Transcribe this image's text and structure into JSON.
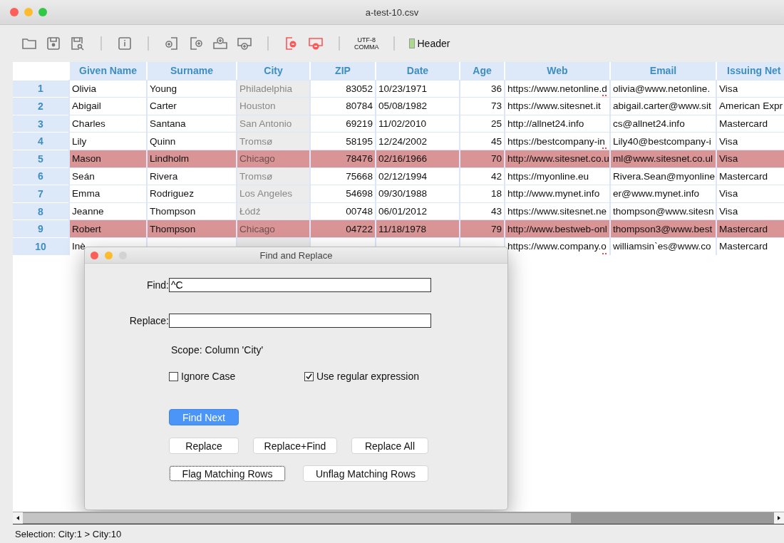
{
  "window": {
    "title": "a-test-10.csv"
  },
  "toolbar": {
    "encoding": "UTF-8",
    "delimiter": "COMMA",
    "header": {
      "label": "Header",
      "checked": true
    }
  },
  "table": {
    "columns": [
      {
        "label": "Given Name",
        "kind": "text",
        "selected": false
      },
      {
        "label": "Surname",
        "kind": "text",
        "selected": false
      },
      {
        "label": "City",
        "kind": "text",
        "selected": true
      },
      {
        "label": "ZIP",
        "kind": "number",
        "selected": false
      },
      {
        "label": "Date",
        "kind": "text",
        "selected": false
      },
      {
        "label": "Age",
        "kind": "number",
        "selected": false
      },
      {
        "label": "Web",
        "kind": "text",
        "selected": false
      },
      {
        "label": "Email",
        "kind": "text",
        "selected": false
      },
      {
        "label": "Issuing Net",
        "kind": "text",
        "selected": false
      }
    ],
    "rows": [
      {
        "number": "1",
        "flagged": false,
        "web_mark": true,
        "cells": [
          "Olivia",
          "Young",
          "Philadelphia",
          "83052",
          "10/23/1971",
          "36",
          "https://www.netonline.d",
          "olivia@www.netonline.",
          "Visa"
        ]
      },
      {
        "number": "2",
        "flagged": false,
        "web_mark": false,
        "cells": [
          "Abigail",
          "Carter",
          "Houston",
          "80784",
          "05/08/1982",
          "73",
          "https://www.sitesnet.it",
          "abigail.carter@www.sit",
          "American Expr"
        ]
      },
      {
        "number": "3",
        "flagged": false,
        "web_mark": false,
        "cells": [
          "Charles",
          "Santana",
          "San Antonio",
          "69219",
          "11/02/2010",
          "25",
          "http://allnet24.info",
          "cs@allnet24.info",
          "Mastercard"
        ]
      },
      {
        "number": "4",
        "flagged": false,
        "web_mark": true,
        "cells": [
          "Lily",
          "Quinn",
          "Tromsø",
          "58195",
          "12/24/2002",
          "45",
          "https://bestcompany-in",
          "Lily40@bestcompany-i",
          "Visa"
        ]
      },
      {
        "number": "5",
        "flagged": true,
        "web_mark": false,
        "cells": [
          "Mason",
          "Lindholm",
          "Chicago",
          "78476",
          "02/16/1966",
          "70",
          "http://www.sitesnet.co.u",
          "ml@www.sitesnet.co.ul",
          "Visa"
        ]
      },
      {
        "number": "6",
        "flagged": false,
        "web_mark": false,
        "cells": [
          "Seán",
          "Rivera",
          "Tromsø",
          "75668",
          "02/12/1994",
          "42",
          "https://myonline.eu",
          "Rivera.Sean@myonline",
          "Mastercard"
        ]
      },
      {
        "number": "7",
        "flagged": false,
        "web_mark": false,
        "cells": [
          "Emma",
          "Rodriguez",
          "Los Angeles",
          "54698",
          "09/30/1988",
          "18",
          "http://www.mynet.info",
          "er@www.mynet.info",
          "Visa"
        ]
      },
      {
        "number": "8",
        "flagged": false,
        "web_mark": false,
        "cells": [
          "Jeanne",
          "Thompson",
          "Łódź",
          "00748",
          "06/01/2012",
          "43",
          "https://www.sitesnet.ne",
          "thompson@www.sitesn",
          "Visa"
        ]
      },
      {
        "number": "9",
        "flagged": true,
        "web_mark": false,
        "cells": [
          "Robert",
          "Thompson",
          "Chicago",
          "04722",
          "11/18/1978",
          "79",
          "http://www.bestweb-onl",
          "thompson3@www.best",
          "Mastercard"
        ]
      },
      {
        "number": "10",
        "flagged": false,
        "web_mark": true,
        "cells": [
          "Inè",
          null,
          null,
          null,
          null,
          null,
          "https://www.company.o",
          "williamsin`es@www.co",
          "Mastercard"
        ]
      }
    ]
  },
  "dialog": {
    "title": "Find and Replace",
    "find": {
      "label": "Find:",
      "value": "^C"
    },
    "replace": {
      "label": "Replace:"
    },
    "scope": "Scope: Column 'City'",
    "options": [
      {
        "label": "Ignore Case",
        "checked": false
      },
      {
        "label": "Use regular expression",
        "checked": true
      }
    ],
    "button_rows": [
      [
        {
          "label": "Find Next",
          "kind": "primary",
          "focused": false
        }
      ],
      [
        {
          "label": "Replace",
          "kind": "normal",
          "focused": false
        },
        {
          "label": "Replace+Find",
          "kind": "normal",
          "focused": false
        },
        {
          "label": "Replace All",
          "kind": "normal",
          "focused": false
        }
      ],
      [
        {
          "label": "Flag Matching Rows",
          "kind": "normal",
          "focused": true
        },
        {
          "label": "Unflag Matching Rows",
          "kind": "normal",
          "focused": false
        }
      ]
    ]
  },
  "status_bar": "Selection: City:1 > City:10"
}
